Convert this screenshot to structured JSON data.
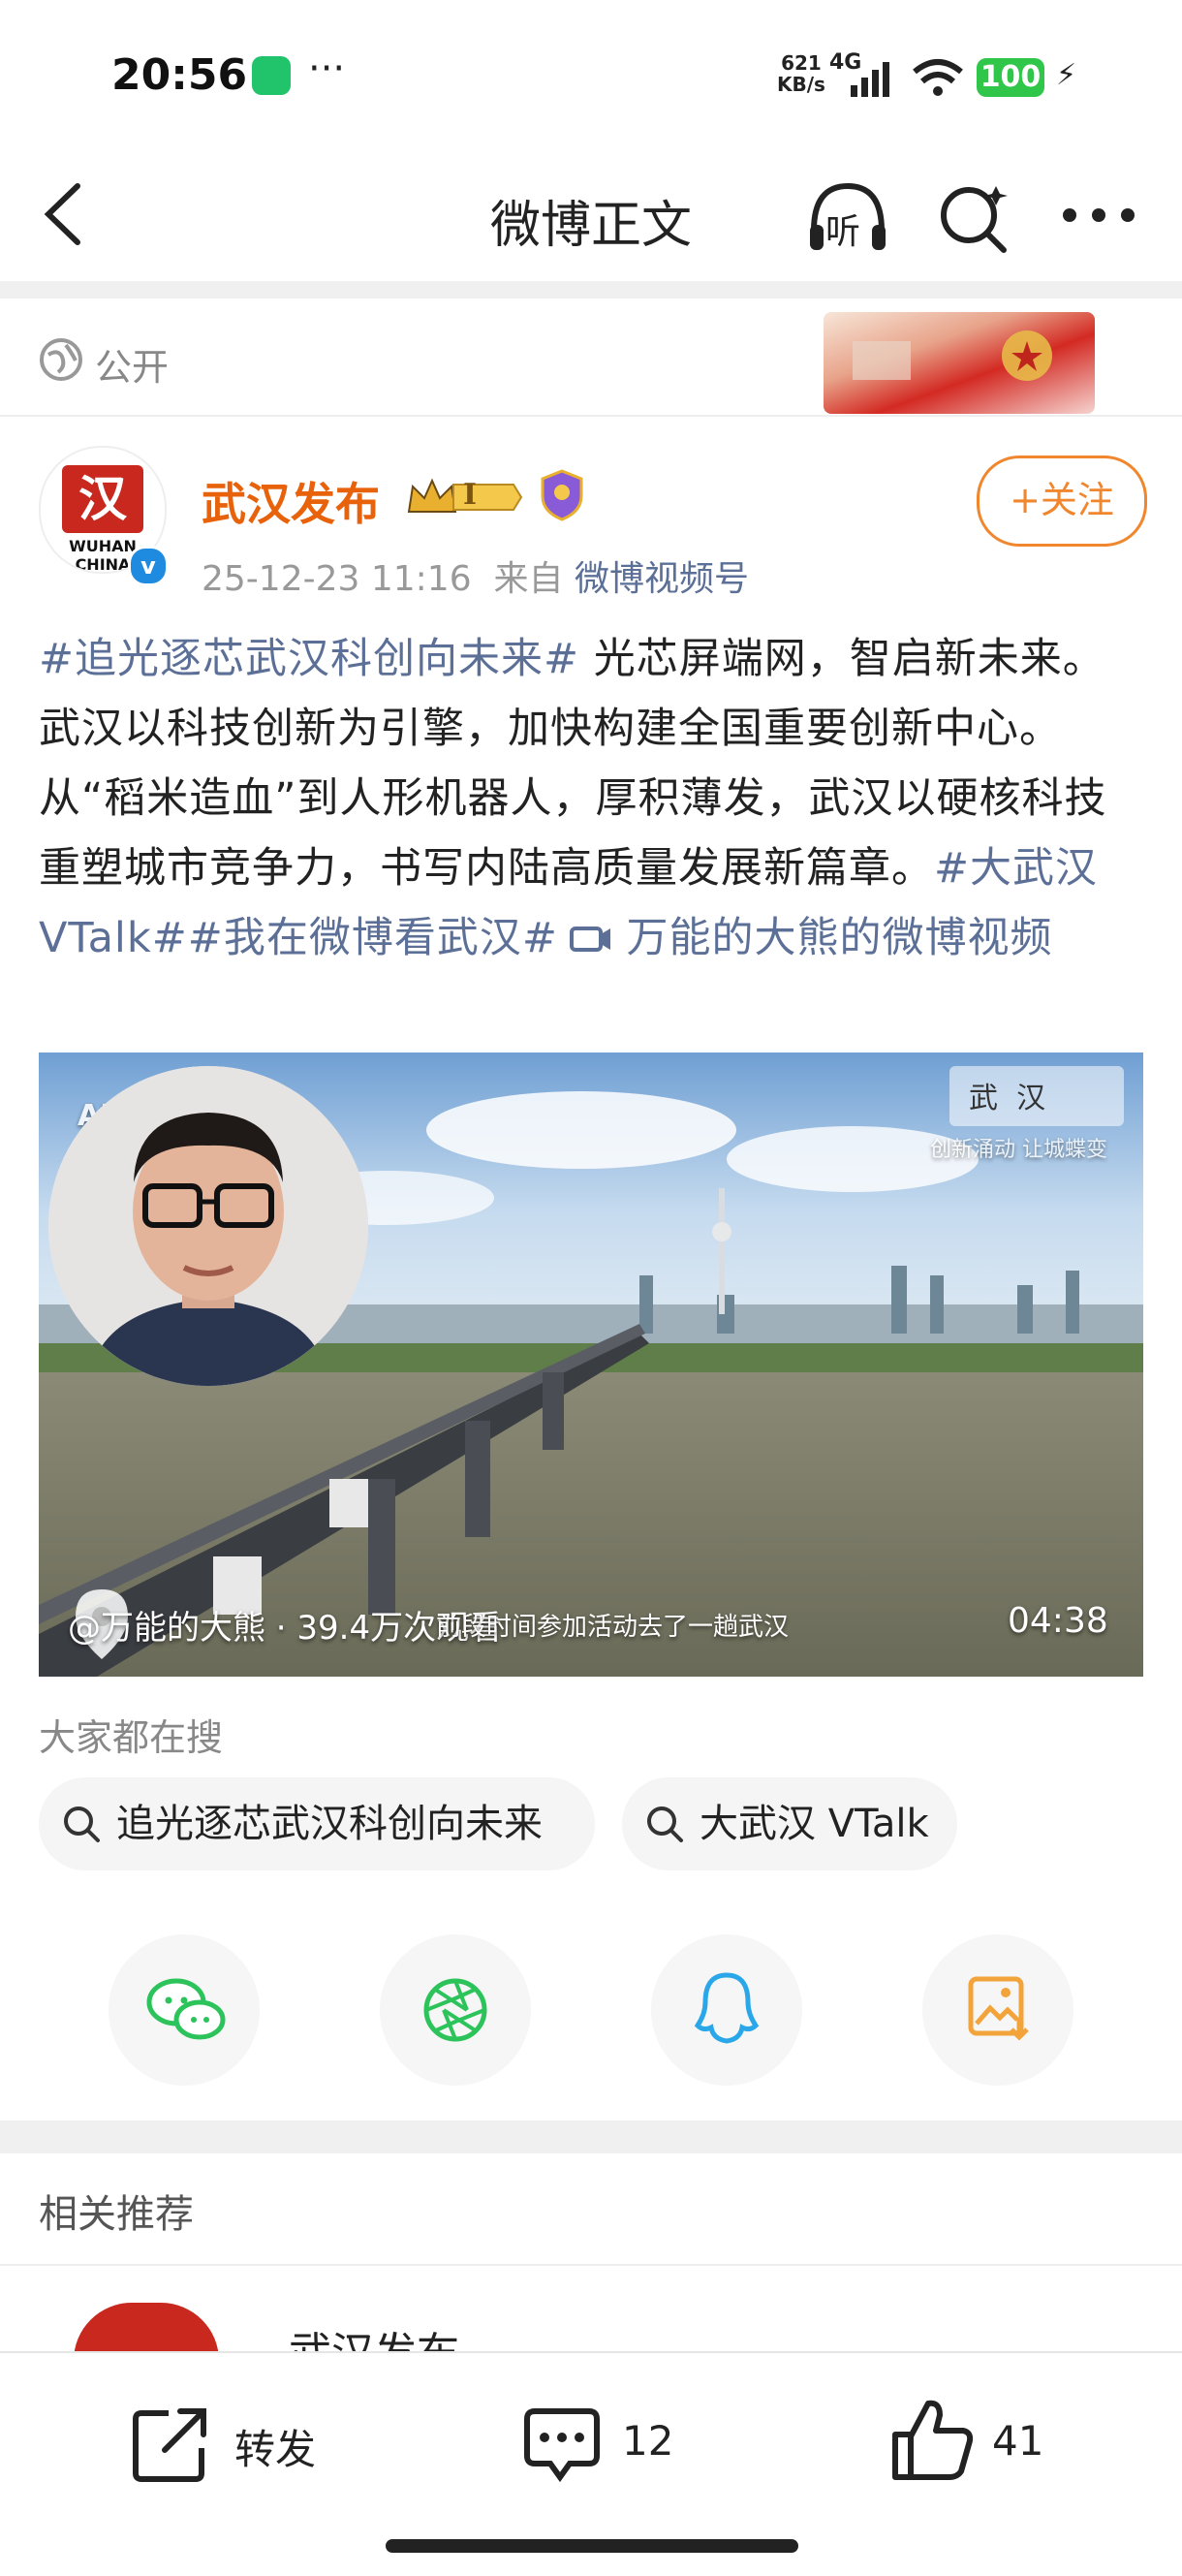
{
  "status": {
    "time": "20:56",
    "net_speed_value": "621",
    "net_speed_unit": "KB/s",
    "network": "4G",
    "battery": "100"
  },
  "nav": {
    "title": "微博正文",
    "listen_label": "听"
  },
  "visibility": "公开",
  "author": {
    "name": "武汉发布",
    "badge_level": "I",
    "avatar_text": "汉",
    "avatar_caption": "WUHAN CHINA",
    "time": "25-12-23 11:16",
    "from_prefix": "来自",
    "source": "微博视频号",
    "follow_label": "+关注"
  },
  "post": {
    "tag1": "#追光逐芯武汉科创向未来#",
    "text1": " 光芯屏端网，智启新未来。武汉以科技创新为引擎，加快构建全国重要创新中心。从“稻米造血”到人形机器人，厚积薄发，武汉以硬核科技重塑城市竞争力，书写内陆高质量发展新篇章。",
    "tag2": "#大武汉VTalk#",
    "tag3": "#我在微博看武汉#",
    "video_link": " 万能的大熊的微博视频"
  },
  "video": {
    "ai_label": "AI生成",
    "brand": "武  汉",
    "brand_sub": "创新涌动 让城蝶变",
    "credit": "@万能的大熊 · 39.4万次观看",
    "subtitle": "前段时间参加活动去了一趟武汉",
    "duration": "04:38"
  },
  "hot_search": {
    "title": "大家都在搜",
    "items": [
      "追光逐芯武汉科创向未来",
      "大武汉 VTalk"
    ]
  },
  "share": {
    "items": [
      "wechat-icon",
      "moments-icon",
      "qq-icon",
      "save-image-icon"
    ],
    "colors": {
      "wechat": "#2bc35a",
      "moments": "#2bc35a",
      "qq": "#2aa7e8",
      "save": "#f2a33a"
    }
  },
  "related": {
    "title": "相关推荐",
    "first_name": "武汉发布"
  },
  "bottom": {
    "repost_label": "转发",
    "comment_count": "12",
    "like_count": "41"
  }
}
